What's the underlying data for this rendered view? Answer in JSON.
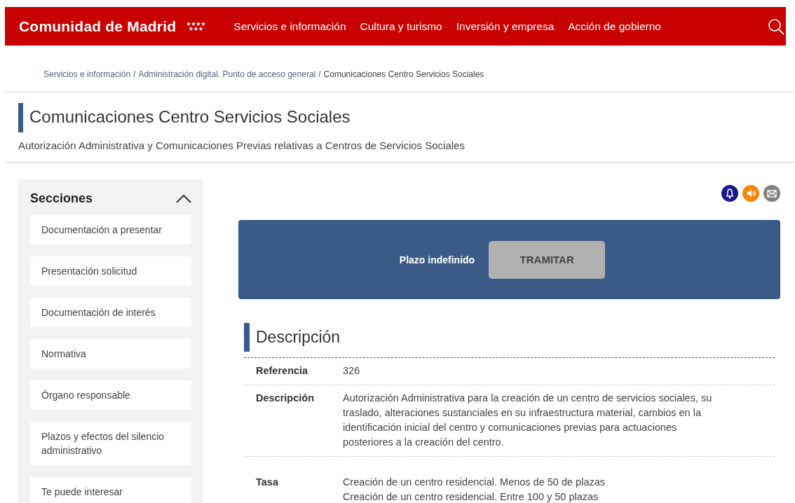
{
  "header": {
    "logo": "Comunidad de Madrid",
    "nav": [
      "Servicios e información",
      "Cultura y turismo",
      "Inversión y empresa",
      "Acción de gobierno"
    ]
  },
  "breadcrumb": [
    {
      "kind": "link",
      "text": "Servicios e información"
    },
    {
      "kind": "separator",
      "text": "/"
    },
    {
      "kind": "link",
      "text": "Administración digital. Punto de acceso general"
    },
    {
      "kind": "separator",
      "text": "/"
    },
    {
      "kind": "current",
      "text": "Comunicaciones Centro Servicios Sociales"
    }
  ],
  "page": {
    "title": "Comunicaciones Centro Servicios Sociales",
    "subtitle": "Autorización Administrativa y Comunicaciones Previas relativas a Centros de Servicios Sociales"
  },
  "sidebar": {
    "title": "Secciones",
    "expanded": true,
    "items": [
      "Documentación a presentar",
      "Presentación solicitud",
      "Documentación de interés",
      "Normativa",
      "Órgano responsable",
      "Plazos y efectos del silencio administrativo",
      "Te puede interesar"
    ]
  },
  "panel": {
    "deadline": "Plazo indefinido",
    "button": {
      "label": "TRAMITAR",
      "disabled": true
    }
  },
  "section": {
    "title": "Descripción",
    "rows": [
      {
        "label": "Referencia",
        "lines": [
          "326"
        ]
      },
      {
        "label": "Descripción",
        "lines": [
          "Autorización Administrativa para la creación de un centro de servicios sociales, su traslado, alteraciones sustanciales en su infraestructura material, cambios en la identificación inicial del centro y comunicaciones previas para actuaciones posteriores a la creación del centro."
        ]
      },
      {
        "label": "Tasa",
        "lines": [
          "Creación de un centro residencial. Menos de 50 de plazas",
          "Creación de un centro residencial. Entre 100 y 50 plazas"
        ]
      }
    ]
  }
}
